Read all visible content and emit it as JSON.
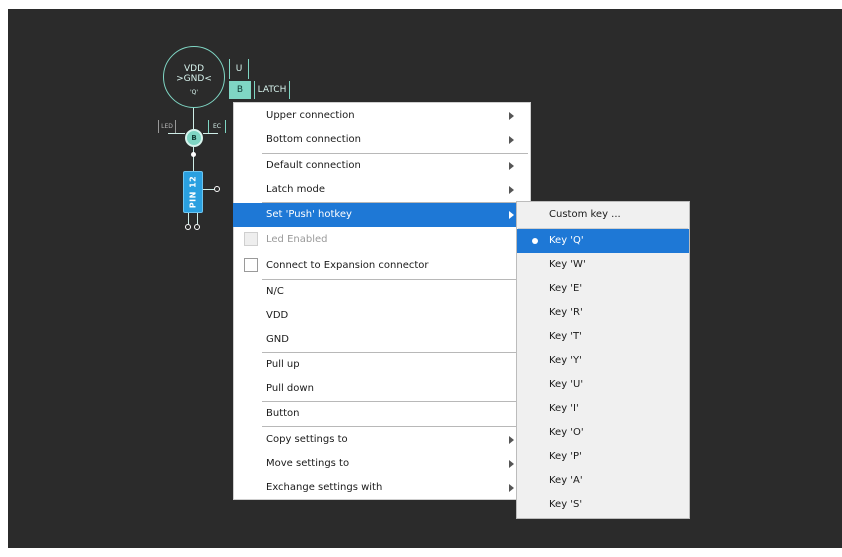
{
  "widget": {
    "vdd_label": "VDD",
    "gnd_label": ">GND<",
    "key_label": "'Q'",
    "u_label": "U",
    "b_label": "B",
    "latch_label": "LATCH",
    "led_label": "LED",
    "ec_label": "EC",
    "button_label": "B",
    "pin_label": "PIN 12"
  },
  "context_menu": {
    "items": [
      {
        "label": "Upper connection",
        "submenu": true
      },
      {
        "label": "Bottom connection",
        "submenu": true
      },
      {
        "label": "Default connection",
        "submenu": true
      },
      {
        "label": "Latch mode",
        "submenu": true
      },
      {
        "label": "Set 'Push' hotkey",
        "submenu": true,
        "selected": true
      },
      {
        "label": "Led Enabled",
        "checkbox": true,
        "checked": false,
        "disabled": true
      },
      {
        "label": "Connect to Expansion connector",
        "checkbox": true,
        "checked": false
      },
      {
        "label": "N/C"
      },
      {
        "label": "VDD"
      },
      {
        "label": "GND"
      },
      {
        "label": "Pull up"
      },
      {
        "label": "Pull down"
      },
      {
        "label": "Button"
      },
      {
        "label": "Copy settings to",
        "submenu": true
      },
      {
        "label": "Move settings to",
        "submenu": true
      },
      {
        "label": "Exchange settings with",
        "submenu": true
      }
    ]
  },
  "hotkey_submenu": {
    "items": [
      {
        "label": "Custom key ..."
      },
      {
        "label": "Key 'Q'",
        "selected": true,
        "radio_checked": true
      },
      {
        "label": "Key 'W'"
      },
      {
        "label": "Key 'E'"
      },
      {
        "label": "Key 'R'"
      },
      {
        "label": "Key 'T'"
      },
      {
        "label": "Key 'Y'"
      },
      {
        "label": "Key 'U'"
      },
      {
        "label": "Key 'I'"
      },
      {
        "label": "Key 'O'"
      },
      {
        "label": "Key 'P'"
      },
      {
        "label": "Key 'A'"
      },
      {
        "label": "Key 'S'"
      }
    ]
  },
  "colors": {
    "canvas_bg": "#2b2b2b",
    "widget_teal": "#7fd6c4",
    "pin_blue": "#2aa0e0",
    "selection_blue": "#1e78d6"
  }
}
